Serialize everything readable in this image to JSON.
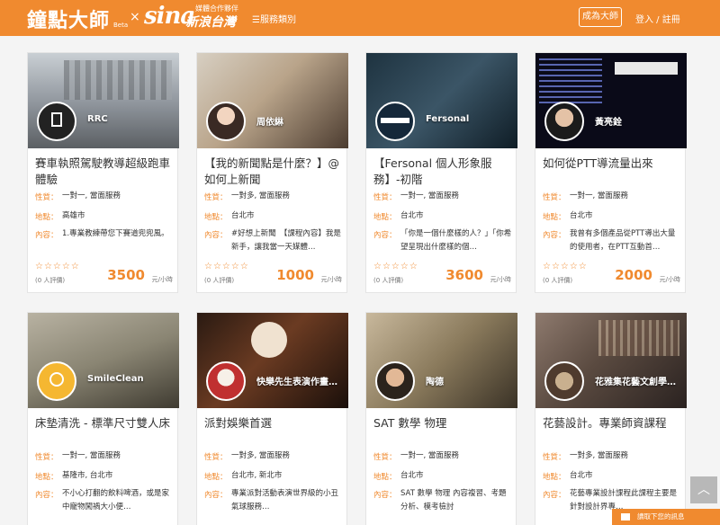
{
  "header": {
    "logo": "鐘點大師",
    "beta": "Beta",
    "times": "×",
    "partner_logo": "sina",
    "partner_tag": "媒體合作夥伴",
    "partner_name": "新浪台灣",
    "category_menu": "☰服務類別",
    "become_master": "成為大師",
    "login": "登入 / 註冊"
  },
  "labels": {
    "type": "性質：",
    "location": "地點：",
    "content": "內容："
  },
  "stars": "☆☆☆☆☆",
  "unit": "元/小時",
  "cards": [
    {
      "avatar_name": "RRC",
      "title": "賽車執照駕駛教導超級跑車體驗",
      "type": "一對一, 當面服務",
      "location": "高雄市",
      "content": "1.專業教練帶您下賽道兜兜風。",
      "reviews": "(0 人評價)",
      "price": "3500"
    },
    {
      "avatar_name": "周依綝",
      "title": "【我的新聞點是什麼？】@如何上新聞",
      "type": "一對多, 當面服務",
      "location": "台北市",
      "content": "#好想上新聞　【課程內容】我是新手，讓我當一天媒體…",
      "reviews": "(0 人評價)",
      "price": "1000"
    },
    {
      "avatar_name": "Fersonal",
      "title": "【Fersonal 個人形象服務】-初階",
      "type": "一對一, 當面服務",
      "location": "台北市",
      "content": "「你是一個什麼樣的人？」「你希望呈現出什麼樣的個…",
      "reviews": "(0 人評價)",
      "price": "3600"
    },
    {
      "avatar_name": "黃亮銓",
      "title": "如何從PTT導流量出來",
      "type": "一對一, 當面服務",
      "location": "台北市",
      "content": "我曾有多個產品從PTT導出大量的使用者，在PTT互動首…",
      "reviews": "(0 人評價)",
      "price": "2000"
    },
    {
      "avatar_name": "SmileClean",
      "title": "床墊清洗 - 標準尺寸雙人床",
      "type": "一對一, 當面服務",
      "location": "基隆市, 台北市",
      "content": "不小心打翻的飲料啤酒，或是家中寵物闖禍大小便…",
      "reviews": "",
      "price": ""
    },
    {
      "avatar_name": "快樂先生表演作畫…",
      "title": "派對娛樂首選",
      "type": "一對多, 當面服務",
      "location": "台北市, 新北市",
      "content": "專業派對活動表演世界級的小丑氣球服務…",
      "reviews": "",
      "price": ""
    },
    {
      "avatar_name": "陶德",
      "title": "SAT 數學 物理",
      "type": "一對一, 當面服務",
      "location": "台北市",
      "content": "SAT 數學 物理 內容複習、考題分析、模考檢討",
      "reviews": "",
      "price": ""
    },
    {
      "avatar_name": "花雅集花藝文創學…",
      "title": "花藝設計。專業師資課程",
      "type": "一對多, 當面服務",
      "location": "台北市",
      "content": "花藝專業設計課程此課程主要是針對設計界專…",
      "reviews": "",
      "price": ""
    }
  ],
  "scroll_top": "︿",
  "message_bar": "讀取下您的訊息"
}
